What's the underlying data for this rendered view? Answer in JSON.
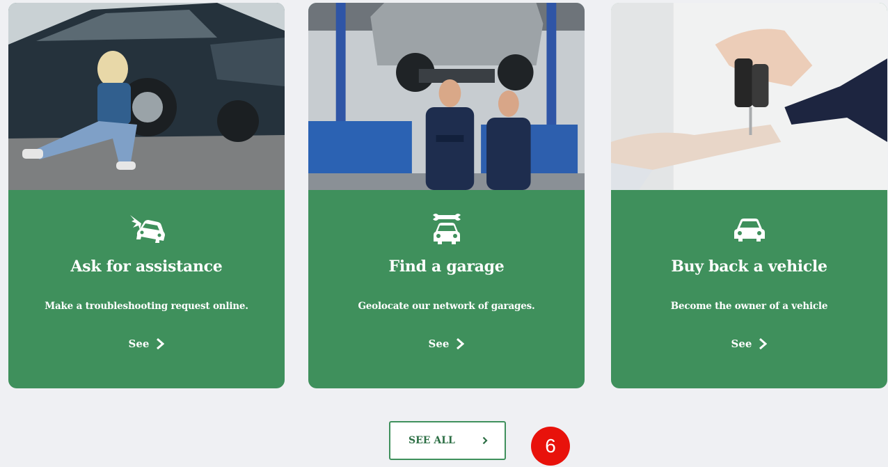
{
  "colors": {
    "card_green": "#3f905c",
    "page_bg": "#eff0f3",
    "marker_red": "#e8120b"
  },
  "cards": [
    {
      "icon": "car-crash-icon",
      "title": "Ask for assistance",
      "description": "Make a troubleshooting request online.",
      "link": "See"
    },
    {
      "icon": "car-repair-wrench-icon",
      "title": "Find a garage",
      "description": "Geolocate our network of garages.",
      "link": "See"
    },
    {
      "icon": "car-icon",
      "title": "Buy back a vehicle",
      "description": "Become the owner of a vehicle",
      "link": "See"
    }
  ],
  "see_all": {
    "label": "SEE ALL",
    "icon": "chevron-right-icon"
  },
  "annotation": {
    "marker": "6"
  }
}
